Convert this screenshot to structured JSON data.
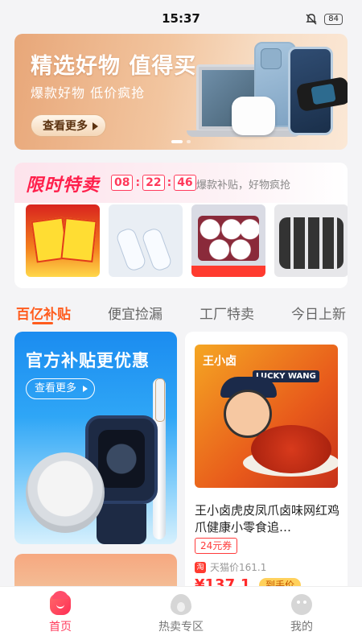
{
  "status_bar": {
    "time": "15:37",
    "battery": "84"
  },
  "banner": {
    "title": "精选好物 值得买",
    "subtitle": "爆款好物 低价疯抢",
    "button": "查看更多"
  },
  "flash_sale": {
    "title": "限时特卖",
    "countdown": {
      "hours": "08",
      "minutes": "22",
      "seconds": "46"
    },
    "slogan": "爆款补贴，好物疯抢"
  },
  "tabs": [
    "百亿补贴",
    "便宜捡漏",
    "工厂特卖",
    "今日上新"
  ],
  "promo": {
    "title": "官方补贴更优惠",
    "button": "查看更多"
  },
  "product": {
    "name": "王小卤虎皮凤爪卤味网红鸡爪健康小零食追…",
    "coupon": "24元券",
    "platform_icon": "淘",
    "platform_price": "天猫价161.1",
    "price": "¥137.1",
    "after_label": "到手价",
    "image_brand": "王小卤",
    "image_tag": "LUCKY WANG"
  },
  "bottom_nav": [
    {
      "label": "首页",
      "icon": "home-icon",
      "active": true
    },
    {
      "label": "热卖专区",
      "icon": "fire-icon",
      "active": false
    },
    {
      "label": "我的",
      "icon": "user-icon",
      "active": false
    }
  ],
  "colors": {
    "accent": "#ff3b5c",
    "tab_active": "#ff5c1e",
    "price": "#ff2a2a"
  }
}
